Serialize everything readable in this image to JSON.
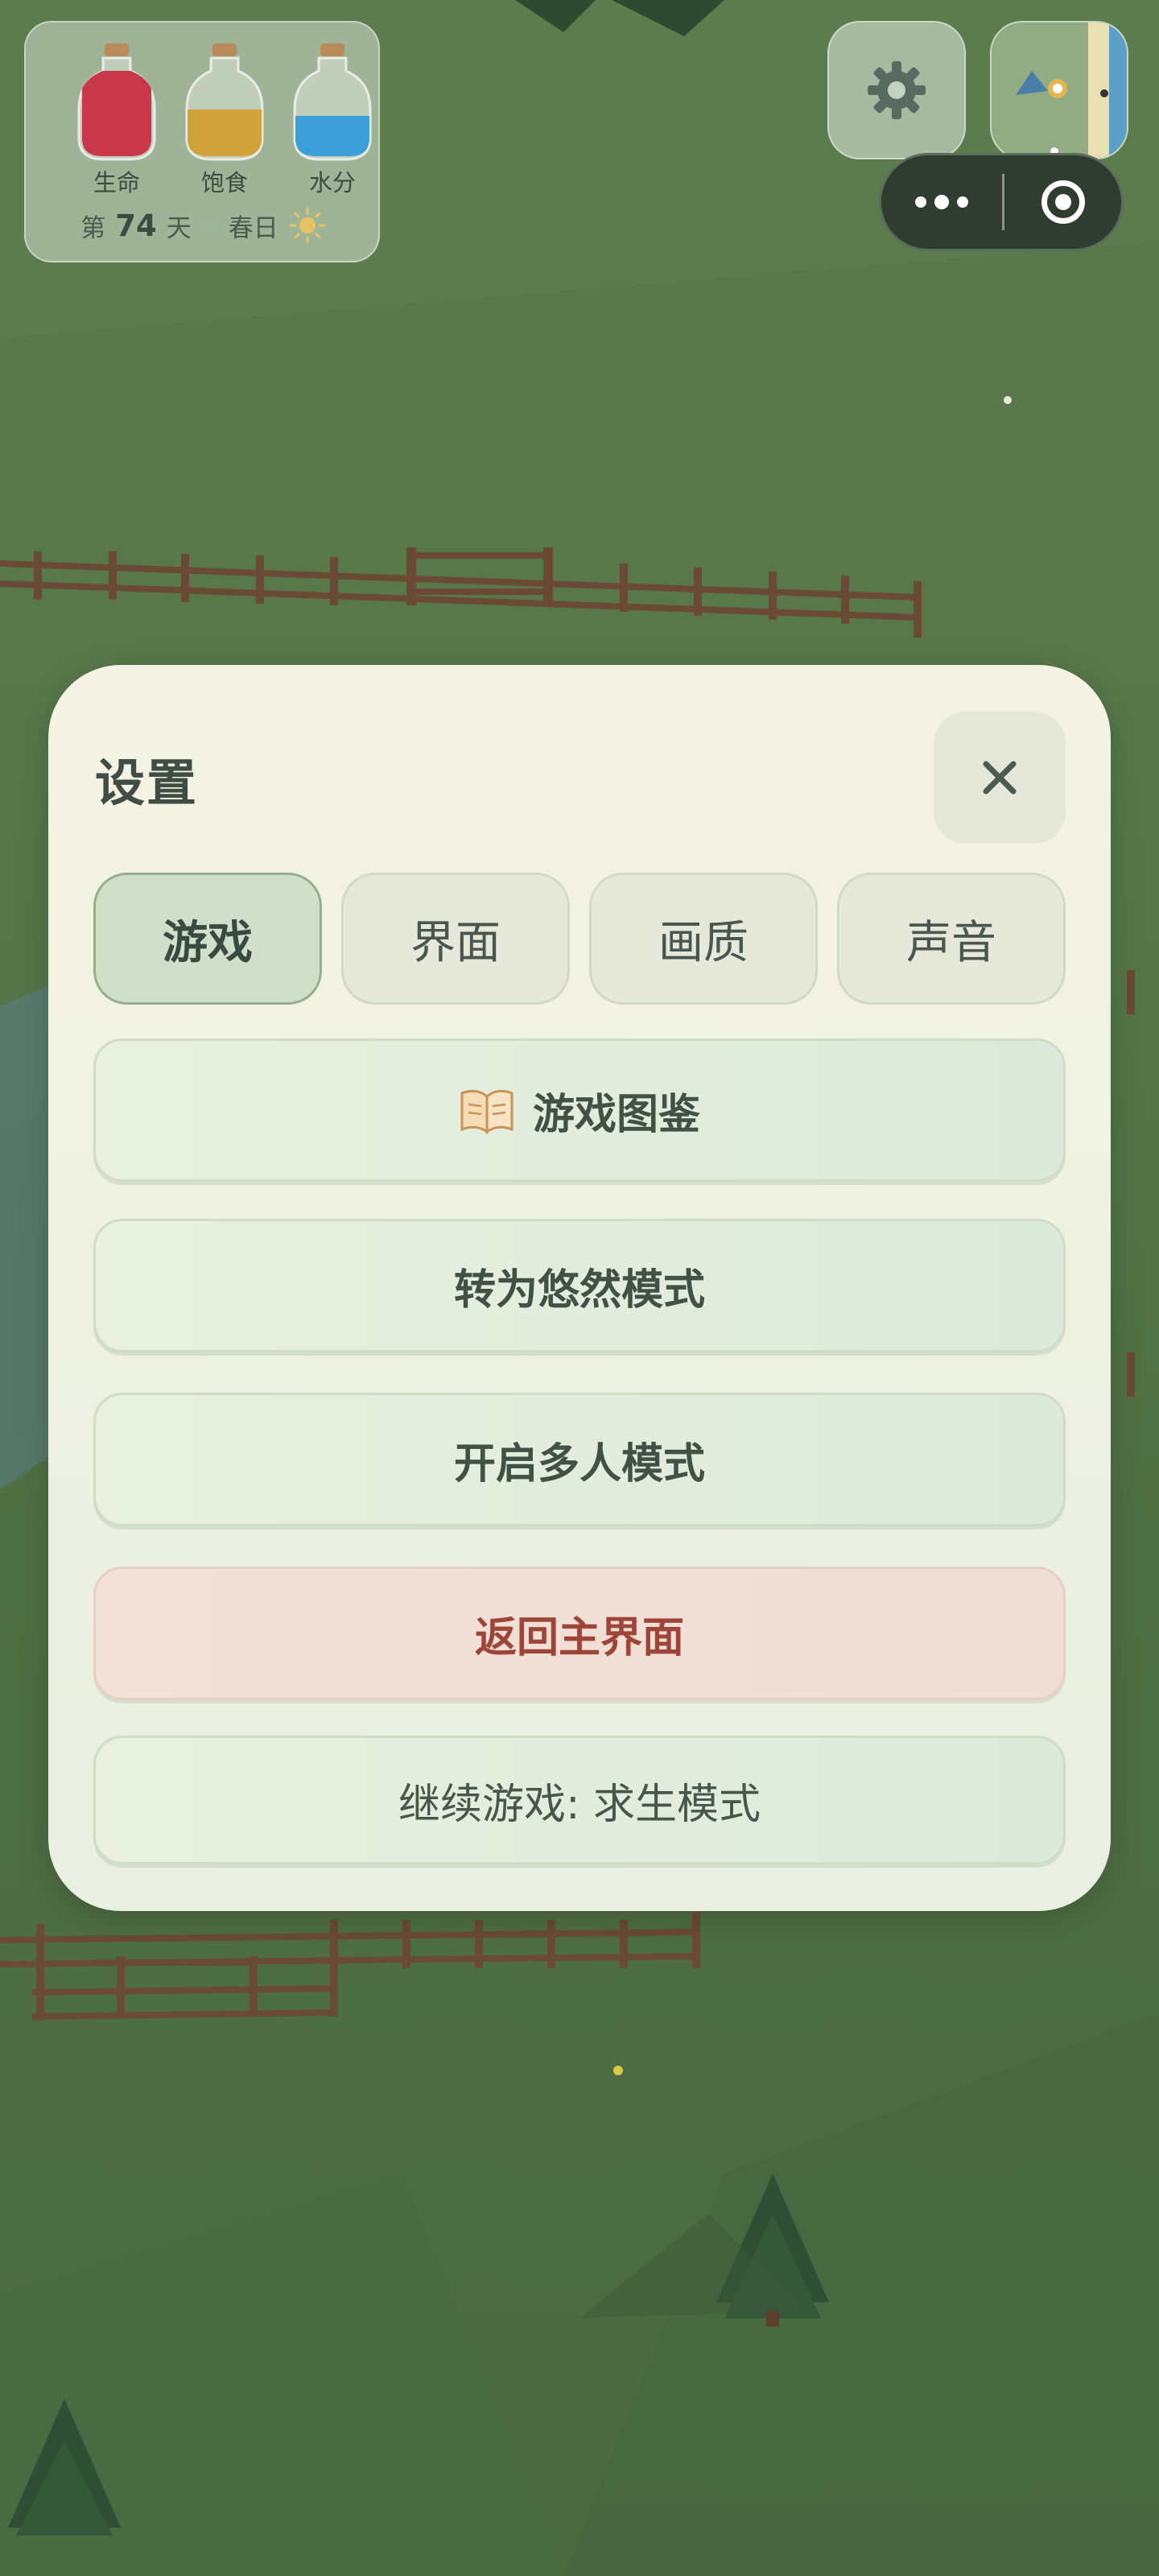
{
  "hud": {
    "bottles": [
      {
        "label": "生命",
        "color": "#c8384a",
        "fill": 0.85
      },
      {
        "label": "饱食",
        "color": "#d2a23a",
        "fill": 0.55
      },
      {
        "label": "水分",
        "color": "#3c9ed8",
        "fill": 0.5
      }
    ],
    "day_prefix": "第",
    "day_number": "74",
    "day_suffix": "天",
    "season": "春日",
    "weather_icon": "sun-icon"
  },
  "top_right": {
    "settings_icon": "gear-icon",
    "minimap_icon": "minimap-icon",
    "more_icon": "more-dots-icon",
    "exit_icon": "target-circle-icon"
  },
  "dialog": {
    "title": "设置",
    "close_icon": "close-icon",
    "tabs": [
      {
        "label": "游戏",
        "active": true
      },
      {
        "label": "界面",
        "active": false
      },
      {
        "label": "画质",
        "active": false
      },
      {
        "label": "声音",
        "active": false
      }
    ],
    "buttons": {
      "encyclopedia": "游戏图鉴",
      "leisure_mode": "转为悠然模式",
      "multiplayer": "开启多人模式",
      "main_menu": "返回主界面",
      "continue": "继续游戏: 求生模式"
    },
    "colors": {
      "accent": "#93ae90",
      "danger_text": "#9c4538"
    }
  }
}
